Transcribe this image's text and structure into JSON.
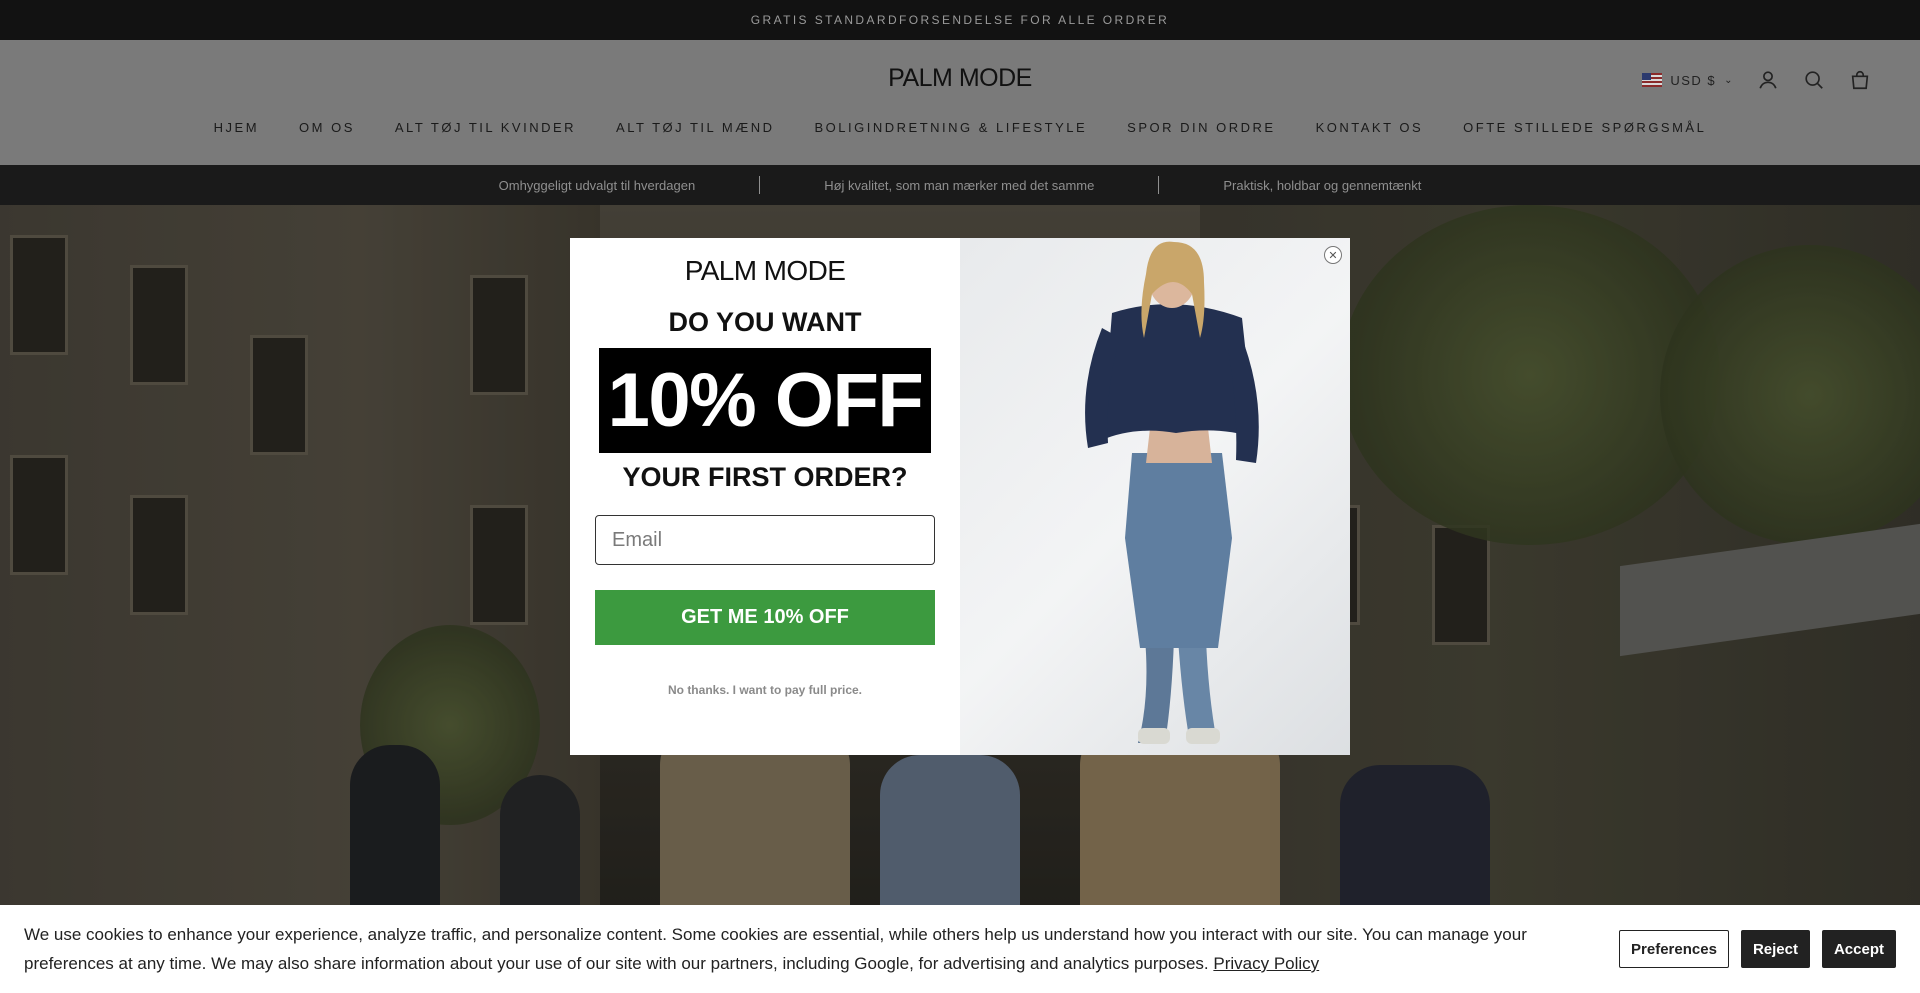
{
  "announcement": "GRATIS STANDARDFORSENDELSE FOR ALLE ORDRER",
  "header": {
    "logo": "PALM MODE",
    "currency": "USD $",
    "icons": [
      "account-icon",
      "search-icon",
      "cart-icon"
    ]
  },
  "nav": [
    "HJEM",
    "OM OS",
    "ALT TØJ TIL KVINDER",
    "ALT TØJ TIL MÆND",
    "BOLIGINDRETNING & LIFESTYLE",
    "SPOR DIN ORDRE",
    "KONTAKT OS",
    "OFTE STILLEDE SPØRGSMÅL"
  ],
  "benefits": [
    "Omhyggeligt udvalgt til hverdagen",
    "Høj kvalitet, som man mærker med det samme",
    "Praktisk, holdbar og gennemtænkt"
  ],
  "popup": {
    "logo": "PALM MODE",
    "line1": "DO YOU WANT",
    "offer": "10% OFF",
    "line2": "YOUR FIRST ORDER?",
    "email_placeholder": "Email",
    "cta": "GET ME 10% OFF",
    "decline": "No thanks. I want to pay full price."
  },
  "cookie": {
    "text": "We use cookies to enhance your experience, analyze traffic, and personalize content. Some cookies are essential, while others help us understand how you interact with our site. You can manage your preferences at any time. We may also share information about your use of our site with our partners, including Google, for advertising and analytics purposes.",
    "link": "Privacy Policy",
    "preferences": "Preferences",
    "reject": "Reject",
    "accept": "Accept"
  }
}
